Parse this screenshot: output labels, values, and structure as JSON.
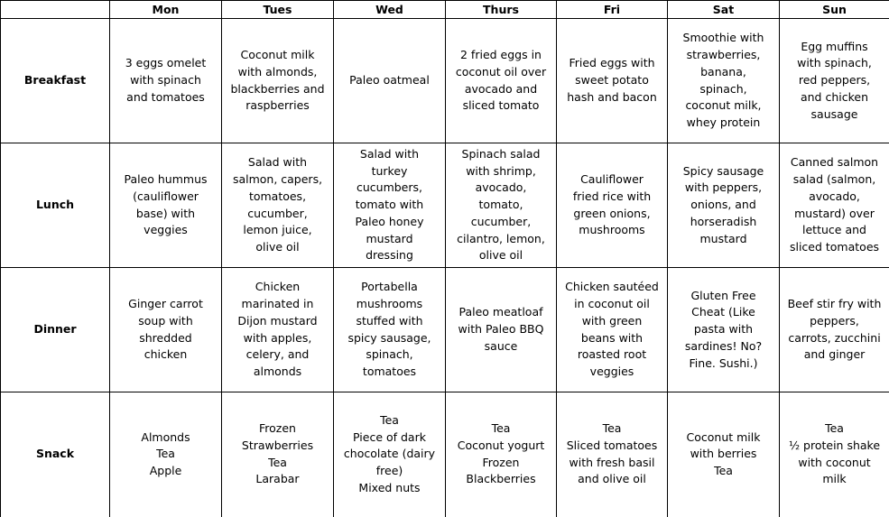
{
  "days": [
    "Mon",
    "Tues",
    "Wed",
    "Thurs",
    "Fri",
    "Sat",
    "Sun"
  ],
  "meals": [
    {
      "name": "Breakfast",
      "cells": [
        [
          "3 eggs omelet",
          "with spinach",
          "and tomatoes"
        ],
        [
          "Coconut milk",
          "with almonds,",
          "blackberries and",
          "raspberries"
        ],
        [
          "Paleo oatmeal"
        ],
        [
          "2 fried eggs in",
          "coconut oil over",
          "avocado and",
          "sliced tomato"
        ],
        [
          "Fried eggs with",
          "sweet potato",
          "hash and bacon"
        ],
        [
          "Smoothie with",
          "strawberries,",
          "banana,",
          "spinach,",
          "coconut milk,",
          "whey protein"
        ],
        [
          "Egg muffins",
          "with spinach,",
          "red peppers,",
          "and chicken",
          "sausage"
        ]
      ]
    },
    {
      "name": "Lunch",
      "cells": [
        [
          "Paleo hummus",
          "(cauliflower",
          "base) with",
          "veggies"
        ],
        [
          "Salad with",
          "salmon, capers,",
          "tomatoes,",
          "cucumber,",
          "lemon juice,",
          "olive oil"
        ],
        [
          "Salad with",
          "turkey",
          "cucumbers,",
          "tomato with",
          "Paleo honey",
          "mustard",
          "dressing"
        ],
        [
          "Spinach salad",
          "with shrimp,",
          "avocado,",
          "tomato,",
          "cucumber,",
          "cilantro, lemon,",
          "olive oil"
        ],
        [
          "Cauliflower",
          "fried rice with",
          "green onions,",
          "mushrooms"
        ],
        [
          "Spicy sausage",
          "with peppers,",
          "onions, and",
          "horseradish",
          "mustard"
        ],
        [
          "Canned salmon",
          "salad (salmon,",
          "avocado,",
          "mustard) over",
          "lettuce and",
          "sliced tomatoes"
        ]
      ]
    },
    {
      "name": "Dinner",
      "cells": [
        [
          "Ginger carrot",
          "soup with",
          "shredded",
          "chicken"
        ],
        [
          "Chicken",
          "marinated in",
          "Dijon mustard",
          "with apples,",
          "celery, and",
          "almonds"
        ],
        [
          "Portabella",
          "mushrooms",
          "stuffed with",
          "spicy sausage,",
          "spinach,",
          "tomatoes"
        ],
        [
          "Paleo meatloaf",
          "with Paleo BBQ",
          "sauce"
        ],
        [
          "Chicken sautéed",
          "in coconut oil",
          "with green",
          "beans with",
          "roasted root",
          "veggies"
        ],
        [
          "Gluten Free",
          "Cheat (Like",
          "pasta with",
          "sardines! No?",
          "Fine. Sushi.)"
        ],
        [
          "Beef stir fry with",
          "peppers,",
          "carrots, zucchini",
          "and ginger"
        ]
      ]
    },
    {
      "name": "Snack",
      "cells": [
        [
          "Almonds",
          "Tea",
          "Apple"
        ],
        [
          "Frozen",
          "Strawberries",
          "Tea",
          "Larabar"
        ],
        [
          "Tea",
          "Piece of dark",
          "chocolate (dairy",
          "free)",
          "Mixed nuts"
        ],
        [
          "Tea",
          "Coconut yogurt",
          "Frozen",
          "Blackberries"
        ],
        [
          "Tea",
          "Sliced tomatoes",
          "with fresh basil",
          "and olive oil"
        ],
        [
          "Coconut milk",
          "with berries",
          "Tea"
        ],
        [
          "Tea",
          "½ protein shake",
          "with coconut",
          "milk"
        ]
      ]
    }
  ]
}
